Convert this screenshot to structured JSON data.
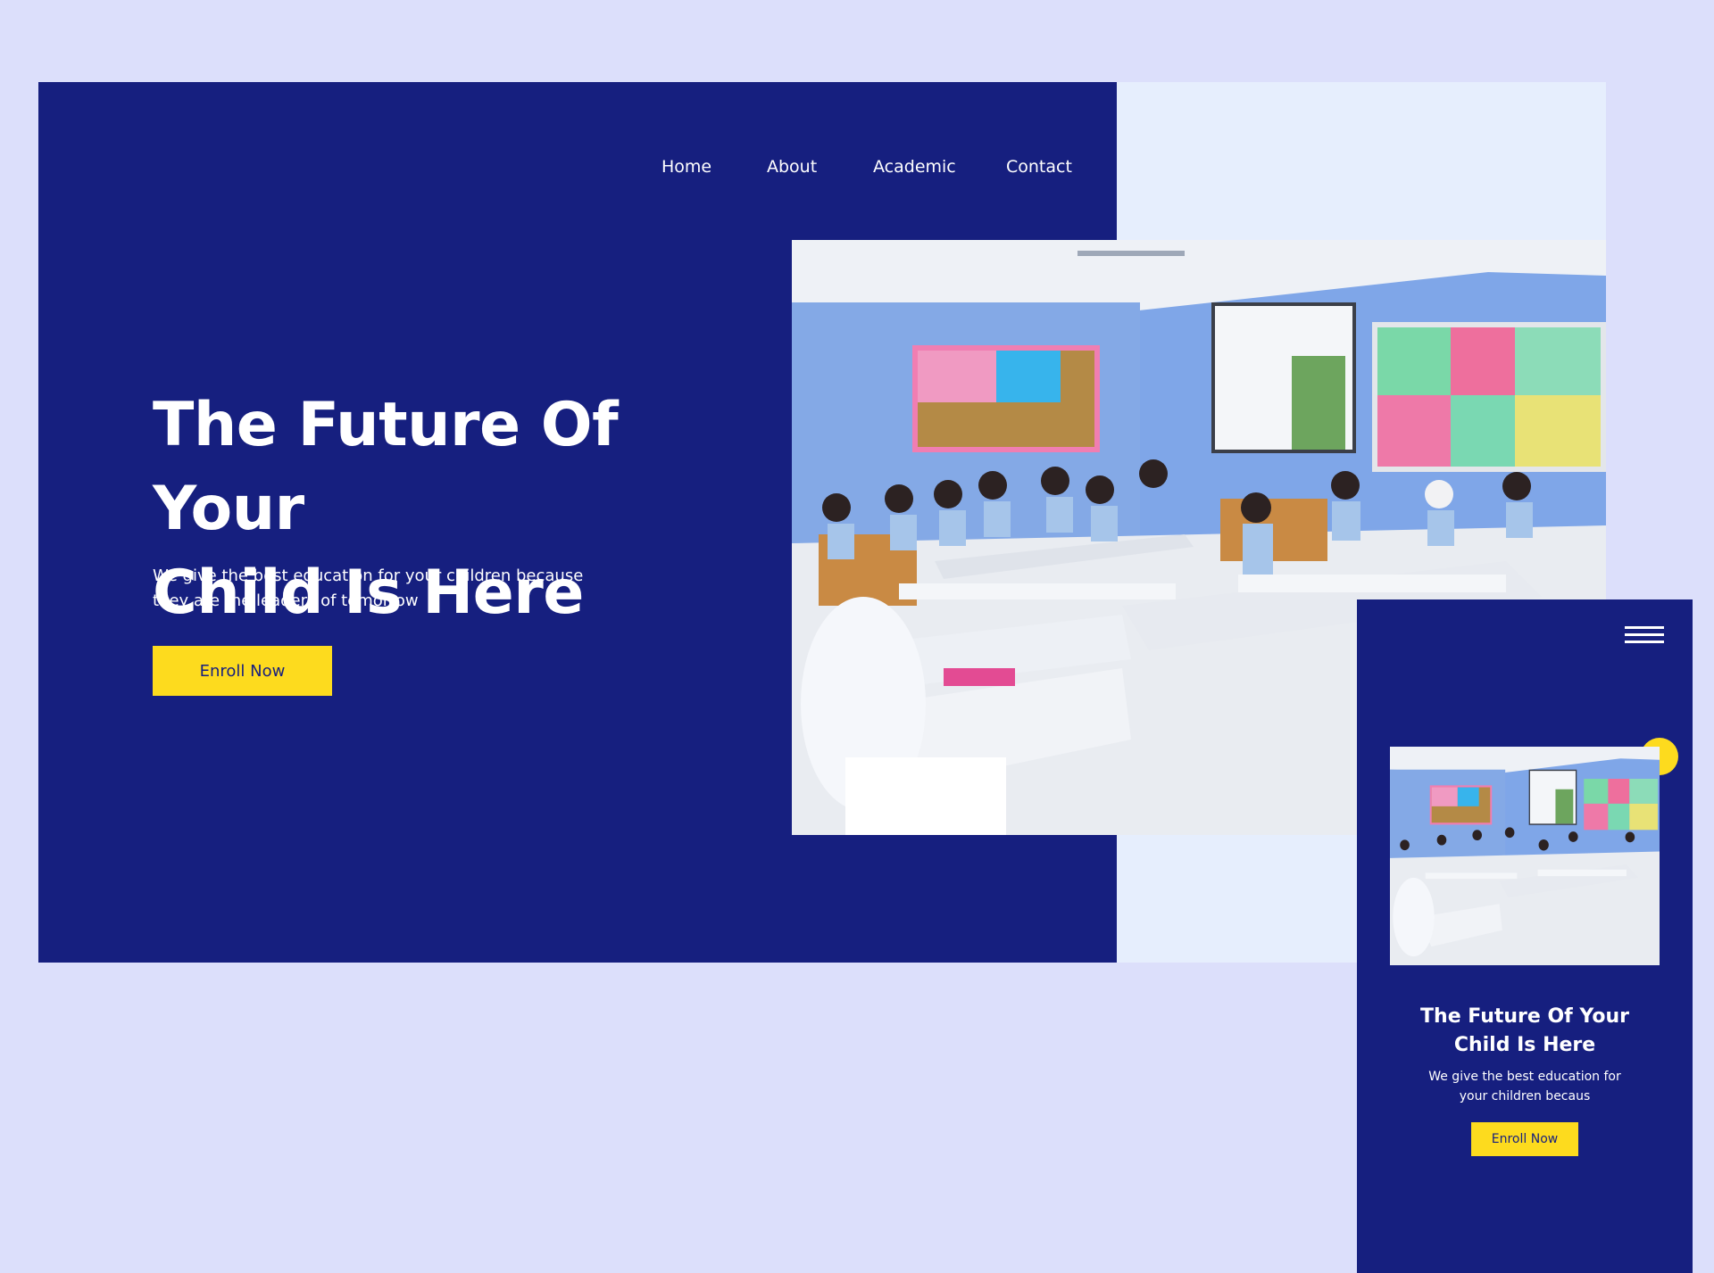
{
  "nav": {
    "items": [
      {
        "label": "Home"
      },
      {
        "label": "About"
      },
      {
        "label": "Academic"
      },
      {
        "label": "Contact"
      }
    ]
  },
  "hero": {
    "title_line1": "The Future Of Your",
    "title_line2": "Child Is Here",
    "subtitle_line1": "We give the best education for your children because",
    "subtitle_line2": "they are the leaders of tomorrow",
    "cta_label": "Enroll Now"
  },
  "mobile": {
    "menu_icon": "hamburger-menu-icon",
    "title_line1": "The Future Of Your",
    "title_line2": "Child Is Here",
    "subtitle_line1": "We give the best education for",
    "subtitle_line2": "your children becaus",
    "cta_label": "Enroll Now"
  },
  "colors": {
    "page_background": "#dcdffb",
    "hero_background": "#161f7f",
    "light_panel": "#e6eefd",
    "accent_yellow": "#fddb1e",
    "text_white": "#ffffff"
  }
}
